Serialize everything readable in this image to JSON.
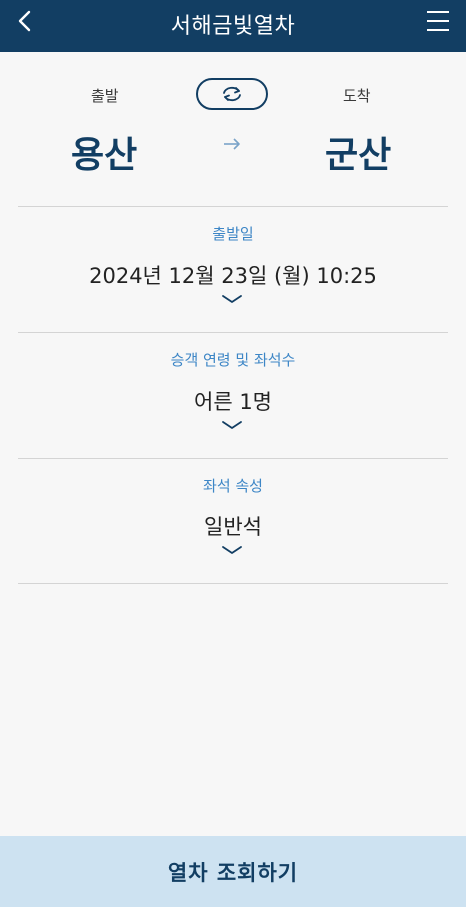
{
  "header": {
    "title": "서해금빛열차",
    "back_icon": "chevron-left-icon",
    "menu_icon": "hamburger-menu-icon"
  },
  "route": {
    "departure_label": "출발",
    "arrival_label": "도착",
    "departure_station": "용산",
    "arrival_station": "군산",
    "swap_icon": "swap-refresh-icon",
    "direction_icon": "arrow-right-icon"
  },
  "date_section": {
    "label": "출발일",
    "value": "2024년 12월 23일 (월) 10:25"
  },
  "passenger_section": {
    "label": "승객 연령 및 좌석수",
    "value": "어른 1명"
  },
  "seat_section": {
    "label": "좌석 속성",
    "value": "일반석"
  },
  "footer": {
    "search_button_label": "열차 조회하기"
  },
  "colors": {
    "primary": "#123e63",
    "accent_label": "#3d86c6",
    "footer_bg": "#cde2f1",
    "page_bg": "#f7f7f7"
  }
}
